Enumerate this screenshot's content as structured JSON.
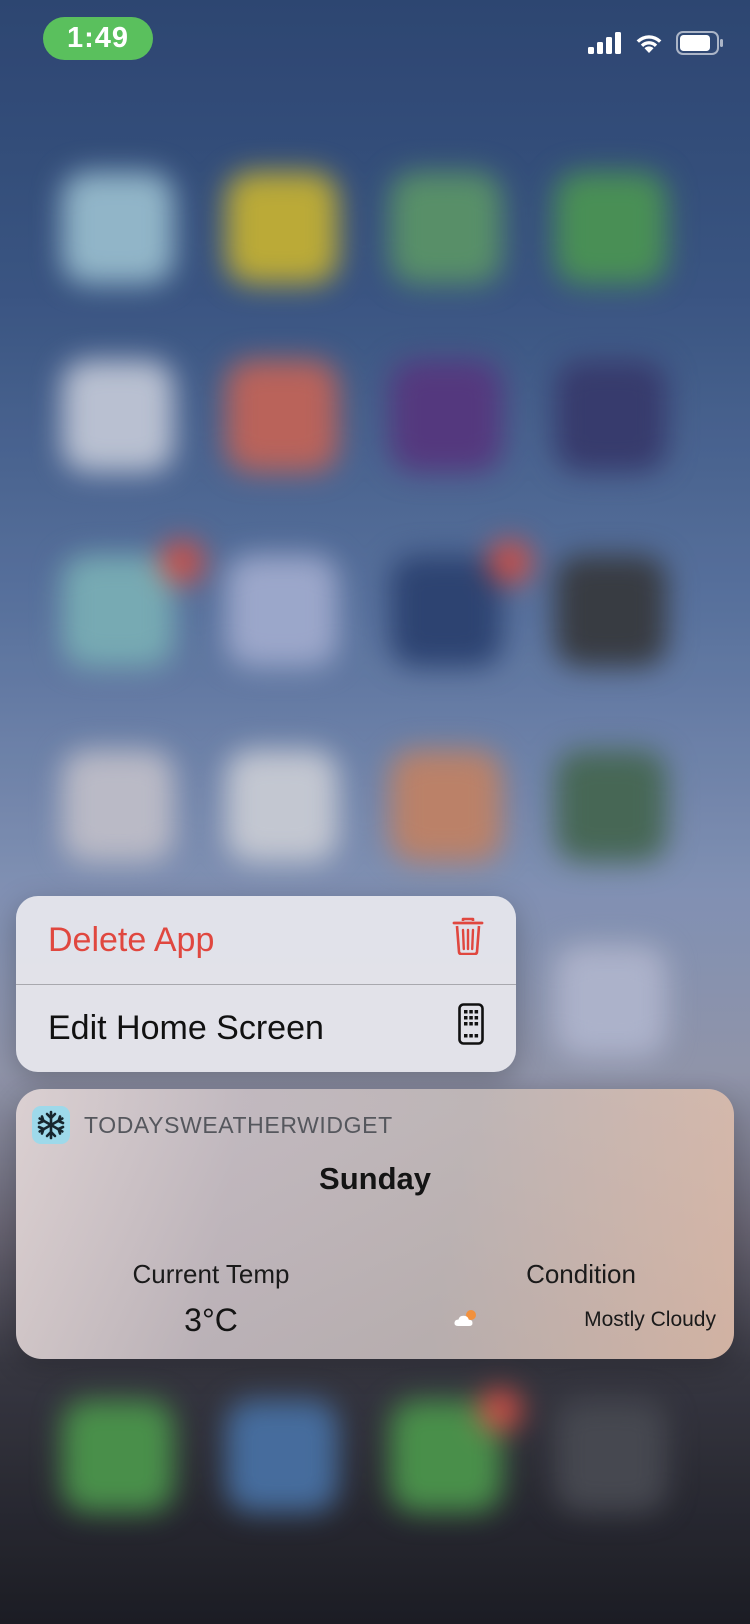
{
  "status_bar": {
    "time": "1:49"
  },
  "icons": {
    "signal": "cellular-signal-icon",
    "wifi": "wifi-icon",
    "battery": "battery-icon",
    "trash": "trash-icon",
    "edit_home": "phone-grid-icon",
    "widget_app": "snowflake-icon",
    "condition": "partly-cloudy-icon"
  },
  "context_menu": {
    "items": [
      {
        "label": "Delete App",
        "icon": "trash-icon",
        "style": "destructive"
      },
      {
        "label": "Edit Home Screen",
        "icon": "phone-grid-icon",
        "style": "default"
      }
    ]
  },
  "widget": {
    "app_name": "TODAYSWEATHERWIDGET",
    "day": "Sunday",
    "temp_label": "Current Temp",
    "temp_value": "3°C",
    "condition_label": "Condition",
    "condition_value": "Mostly Cloudy"
  },
  "colors": {
    "time_pill": "#5ac05d",
    "destructive": "#e0473f",
    "widget_icon_bg": "#9ed9ea"
  }
}
